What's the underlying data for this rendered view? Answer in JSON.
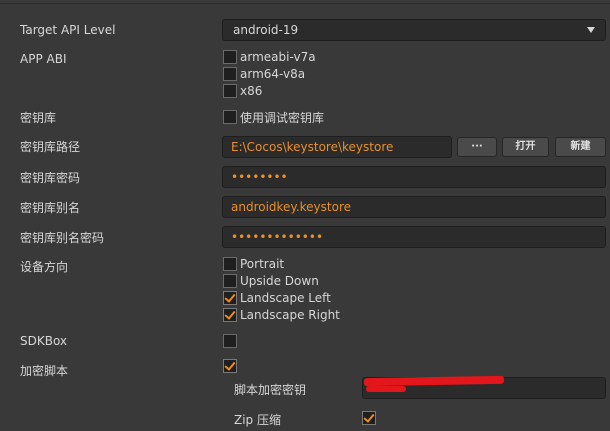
{
  "labels": {
    "target_api": "Target API Level",
    "app_abi": "APP ABI",
    "keystore": "密钥库",
    "keystore_path": "密钥库路径",
    "keystore_password": "密钥库密码",
    "keystore_alias": "密钥库别名",
    "keystore_alias_password": "密钥库别名密码",
    "orientation": "设备方向",
    "sdkbox": "SDKBox",
    "encrypt_script": "加密脚本",
    "script_key": "脚本加密密钥",
    "zip": "Zip 压缩"
  },
  "target_api": {
    "value": "android-19"
  },
  "abi": [
    {
      "label": "armeabi-v7a",
      "checked": false
    },
    {
      "label": "arm64-v8a",
      "checked": false
    },
    {
      "label": "x86",
      "checked": false
    }
  ],
  "debug_keystore": {
    "label": "使用调试密钥库",
    "checked": false
  },
  "keystore_path": {
    "value": "E:\\Cocos\\keystore\\keystore",
    "browse_label": "···",
    "open_label": "打开",
    "new_label": "新建"
  },
  "keystore_password": {
    "value": "••••••••"
  },
  "alias": {
    "value": "androidkey.keystore"
  },
  "alias_password": {
    "value": "•••••••••••••"
  },
  "orientation": [
    {
      "label": "Portrait",
      "checked": false
    },
    {
      "label": "Upside Down",
      "checked": false
    },
    {
      "label": "Landscape Left",
      "checked": true
    },
    {
      "label": "Landscape Right",
      "checked": true
    }
  ],
  "sdkbox_checked": false,
  "encrypt_checked": true,
  "zip_checked": true,
  "colors": {
    "background": "#393939",
    "field": "#2b2b2b",
    "accent": "#e8902a",
    "redaction": "#e3161c"
  }
}
